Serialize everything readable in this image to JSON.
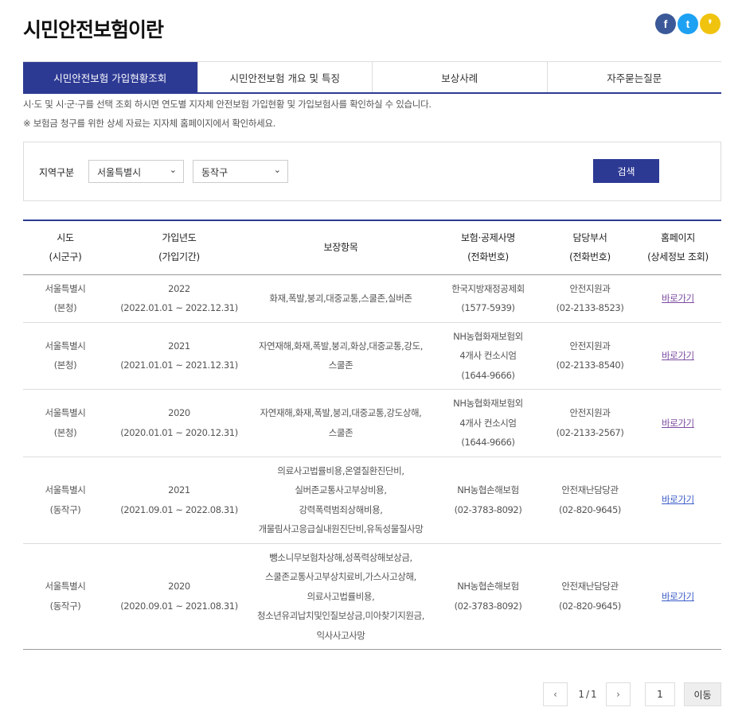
{
  "page": {
    "title": "시민안전보험이란"
  },
  "sns": [
    {
      "name": "facebook-icon",
      "glyph": "f",
      "color": "#3b5998"
    },
    {
      "name": "twitter-icon",
      "glyph": "t",
      "color": "#1da1f2"
    },
    {
      "name": "kakao-icon",
      "glyph": "❜",
      "color": "#f0c30f"
    }
  ],
  "tabs": [
    "시민안전보험 가입현황조회",
    "시민안전보험 개요 및 특징",
    "보상사례",
    "자주묻는질문"
  ],
  "notices": [
    "시·도 및 시·군·구를 선택 조회 하시면 연도별 지자체 안전보험 가입현황 및 가입보험사를 확인하실 수 있습니다.",
    "※ 보험금 청구를 위한 상세 자료는 지자체 홈페이지에서 확인하세요."
  ],
  "search": {
    "label": "지역구분",
    "sido": "서울특별시",
    "sigungu": "동작구",
    "button": "검색"
  },
  "table": {
    "headers": [
      [
        "시도",
        "(시군구)"
      ],
      [
        "가입년도",
        "(가입기간)"
      ],
      [
        "보장항목"
      ],
      [
        "보험·공제사명",
        "(전화번호)"
      ],
      [
        "담당부서",
        "(전화번호)"
      ],
      [
        "홈페이지",
        "(상세정보 조회)"
      ]
    ],
    "rows": [
      {
        "region": [
          "서울특별시",
          "(본청)"
        ],
        "year": [
          "2022",
          "(2022.01.01 ~ 2022.12.31)"
        ],
        "coverage": [
          "화재,폭발,붕괴,대중교통,스쿨존,실버존"
        ],
        "insurer": [
          "한국지방재정공제회",
          "(1577-5939)"
        ],
        "dept": [
          "안전지원과",
          "(02-2133-8523)"
        ],
        "link": "바로가기"
      },
      {
        "region": [
          "서울특별시",
          "(본청)"
        ],
        "year": [
          "2021",
          "(2021.01.01 ~ 2021.12.31)"
        ],
        "coverage": [
          "자연재해,화재,폭발,붕괴,화상,대중교통,강도,",
          "스쿨존"
        ],
        "insurer": [
          "NH농협화재보험외",
          "4개사 컨소시엄",
          "(1644-9666)"
        ],
        "dept": [
          "안전지원과",
          "(02-2133-8540)"
        ],
        "link": "바로가기"
      },
      {
        "region": [
          "서울특별시",
          "(본청)"
        ],
        "year": [
          "2020",
          "(2020.01.01 ~ 2020.12.31)"
        ],
        "coverage": [
          "자연재해,화재,폭발,붕괴,대중교통,강도상해,",
          "스쿨존"
        ],
        "insurer": [
          "NH농협화재보험외",
          "4개사 컨소시엄",
          "(1644-9666)"
        ],
        "dept": [
          "안전지원과",
          "(02-2133-2567)"
        ],
        "link": "바로가기"
      },
      {
        "region": [
          "서울특별시",
          "(동작구)"
        ],
        "year": [
          "2021",
          "(2021.09.01 ~ 2022.08.31)"
        ],
        "coverage": [
          "의료사고법률비용,온열질환진단비,",
          "실버존교통사고부상비용,",
          "강력폭력범죄상해비용,",
          "개물림사고응급실내원진단비,유독성물질사망"
        ],
        "insurer": [
          "NH농협손해보험",
          "(02-3783-8092)"
        ],
        "dept": [
          "안전재난담당관",
          "(02-820-9645)"
        ],
        "link": "바로가기"
      },
      {
        "region": [
          "서울특별시",
          "(동작구)"
        ],
        "year": [
          "2020",
          "(2020.09.01 ~ 2021.08.31)"
        ],
        "coverage": [
          "뺑소니무보험차상해,성폭력상해보상금,",
          "스쿨존교통사고부상치료비,가스사고상해,",
          "의료사고법률비용,",
          "청소년유괴납치및인질보상금,미아찾기지원금,",
          "익사사고사망"
        ],
        "insurer": [
          "NH농협손해보험",
          "(02-3783-8092)"
        ],
        "dept": [
          "안전재난담당관",
          "(02-820-9645)"
        ],
        "link": "바로가기"
      }
    ]
  },
  "pagination": {
    "prev": "‹",
    "next": "›",
    "current": "1",
    "separator": "/",
    "total": "1",
    "input_value": "1",
    "go_button": "이동"
  }
}
